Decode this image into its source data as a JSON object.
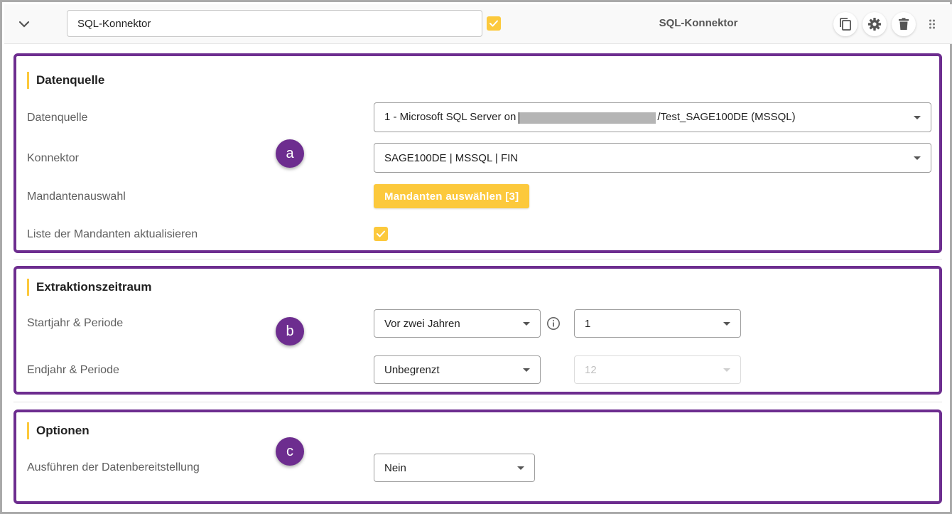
{
  "header": {
    "name_value": "SQL-Konnektor",
    "title": "SQL-Konnektor",
    "active_checked": true,
    "icons": [
      "chevron-down-icon",
      "copy-icon",
      "gear-icon",
      "trash-icon",
      "drag-handle-icon"
    ]
  },
  "sections": {
    "datenquelle": {
      "title": "Datenquelle",
      "badge": "a",
      "fields": {
        "datenquelle_label": "Datenquelle",
        "datenquelle_value_prefix": "1 - Microsoft SQL Server on",
        "datenquelle_value_suffix": "/Test_SAGE100DE (MSSQL)",
        "konnektor_label": "Konnektor",
        "konnektor_value": "SAGE100DE | MSSQL | FIN",
        "mandantenauswahl_label": "Mandantenauswahl",
        "mandanten_button": "Mandanten auswählen [3]",
        "liste_label": "Liste der Mandanten aktualisieren",
        "liste_checked": true
      }
    },
    "extraktion": {
      "title": "Extraktionszeitraum",
      "badge": "b",
      "fields": {
        "startjahr_label": "Startjahr & Periode",
        "startjahr_value": "Vor zwei Jahren",
        "startperiode_value": "1",
        "endjahr_label": "Endjahr & Periode",
        "endjahr_value": "Unbegrenzt",
        "endperiode_value": "12"
      }
    },
    "optionen": {
      "title": "Optionen",
      "badge": "c",
      "fields": {
        "ausfuehren_label": "Ausführen der Datenbereitstellung",
        "ausfuehren_value": "Nein"
      }
    }
  },
  "colors": {
    "accent_yellow": "#fcc93c",
    "highlight_purple": "#6d2d8f"
  }
}
